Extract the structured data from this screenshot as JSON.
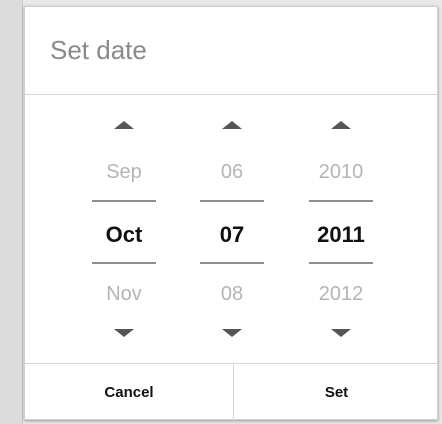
{
  "dialog": {
    "title": "Set date"
  },
  "picker": {
    "month": {
      "prev": "Sep",
      "current": "Oct",
      "next": "Nov"
    },
    "day": {
      "prev": "06",
      "current": "07",
      "next": "08"
    },
    "year": {
      "prev": "2010",
      "current": "2011",
      "next": "2012"
    }
  },
  "buttons": {
    "cancel": "Cancel",
    "set": "Set"
  },
  "icons": {
    "increment": "chevron-up-icon",
    "decrement": "chevron-down-icon"
  },
  "colors": {
    "text_primary": "#111111",
    "text_muted": "#b5b5b5",
    "title_text": "#8a8a8a",
    "divider": "#d7d7d7"
  }
}
